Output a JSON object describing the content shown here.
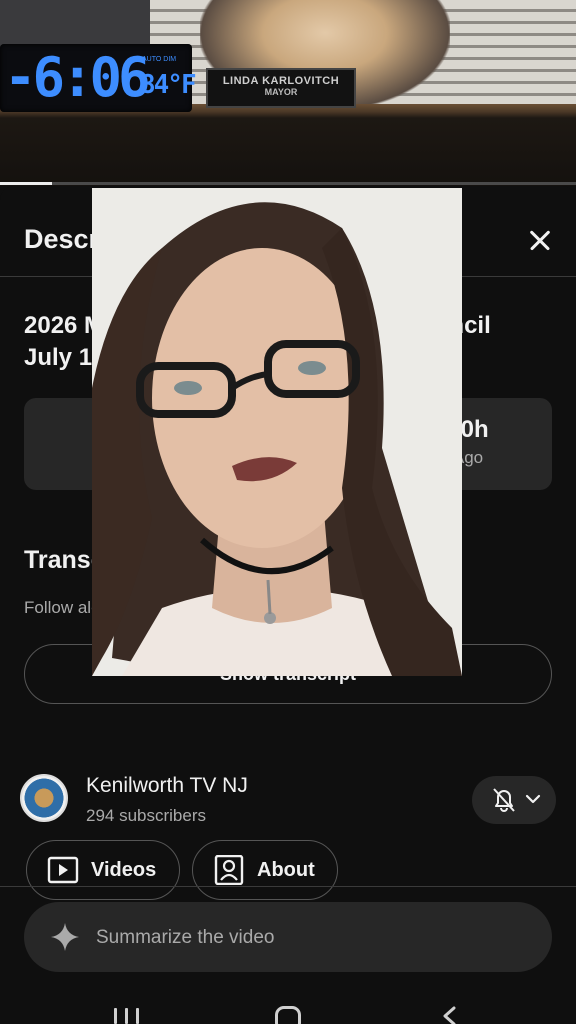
{
  "video": {
    "clock_time": "-6:06",
    "clock_temp": "84°F",
    "clock_mini_label": "AUTO DIM",
    "nameplate_name": "LINDA KARLOVITCH",
    "nameplate_title": "MAYOR",
    "progress_fraction": 0.09
  },
  "sheet": {
    "title": "Description",
    "video_title": "2026 Mayor and Council Meeting Council July 1, 2026",
    "stats": [
      {
        "value": "",
        "label": "L"
      },
      {
        "value": "10h",
        "label": "Ago"
      }
    ],
    "transcript": {
      "title": "Transcript",
      "subtitle": "Follow along using the transcript.",
      "button_label": "Show transcript"
    },
    "channel": {
      "name": "Kenilworth TV NJ",
      "subscribers": "294 subscribers",
      "videos_label": "Videos",
      "about_label": "About"
    }
  },
  "summarize": {
    "label": "Summarize the video"
  },
  "icons": {
    "close": "close-icon",
    "bell": "bell-off-icon",
    "chevron": "chevron-down-icon",
    "videos": "play-icon",
    "about": "person-card-icon",
    "sparkle": "sparkle-icon"
  },
  "colors": {
    "background": "#0f0f0f",
    "card": "#272727",
    "secondary_text": "#aaaaaa",
    "clock_digits": "#3d8dff"
  }
}
